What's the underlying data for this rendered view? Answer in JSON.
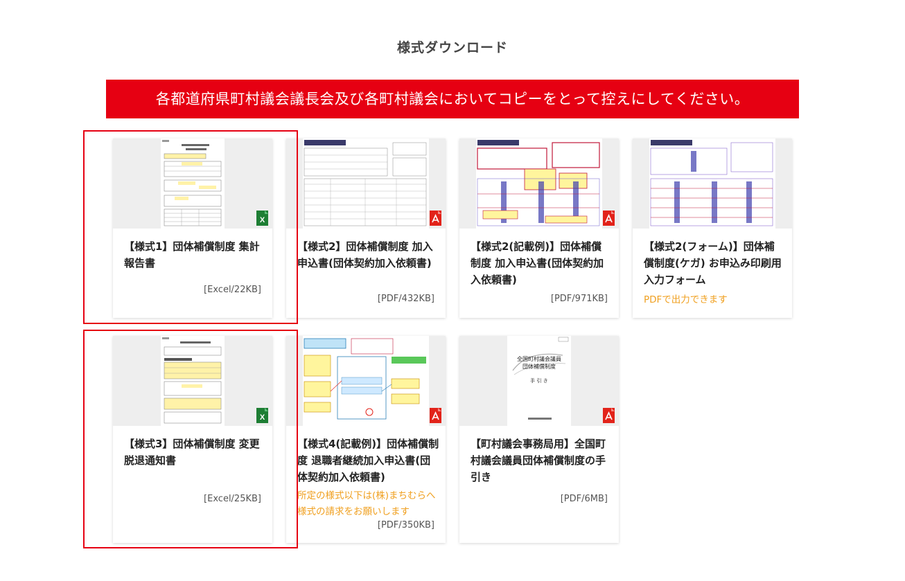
{
  "page": {
    "title": "様式ダウンロード",
    "notice": "各都道府県町村議会議長会及び各町村議会においてコピーをとって控えにしてください。"
  },
  "cards": [
    {
      "title": "【様式1】団体補償制度 集計報告書",
      "file": "[Excel/22KB]",
      "type": "excel"
    },
    {
      "title": "【様式2】団体補償制度 加入申込書(団体契約加入依頼書)",
      "file": "[PDF/432KB]",
      "type": "pdf"
    },
    {
      "title": "【様式2(記載例)】団体補償制度 加入申込書(団体契約加入依頼書)",
      "file": "[PDF/971KB]",
      "type": "pdf"
    },
    {
      "title": "【様式2(フォーム)】団体補償制度(ケガ) お申込み印刷用入力フォーム",
      "note": "PDFで出力できます",
      "type": "pdf"
    },
    {
      "title": "【様式3】団体補償制度 変更脱退通知書",
      "file": "[Excel/25KB]",
      "type": "excel"
    },
    {
      "title": "【様式4(記載例)】団体補償制度 退職者継続加入申込書(団体契約加入依頼書)",
      "note": "所定の様式以下は(株)まちむらへ様式の請求をお願いします",
      "file": "[PDF/350KB]",
      "type": "pdf"
    },
    {
      "title": "【町村議会事務局用】全国町村議会議員団体補償制度の手引き",
      "file": "[PDF/6MB]",
      "type": "pdf"
    }
  ],
  "manual_cover": {
    "line1": "全国町村議会議員",
    "line2": "団体補償制度",
    "line3": "手 引 き"
  }
}
